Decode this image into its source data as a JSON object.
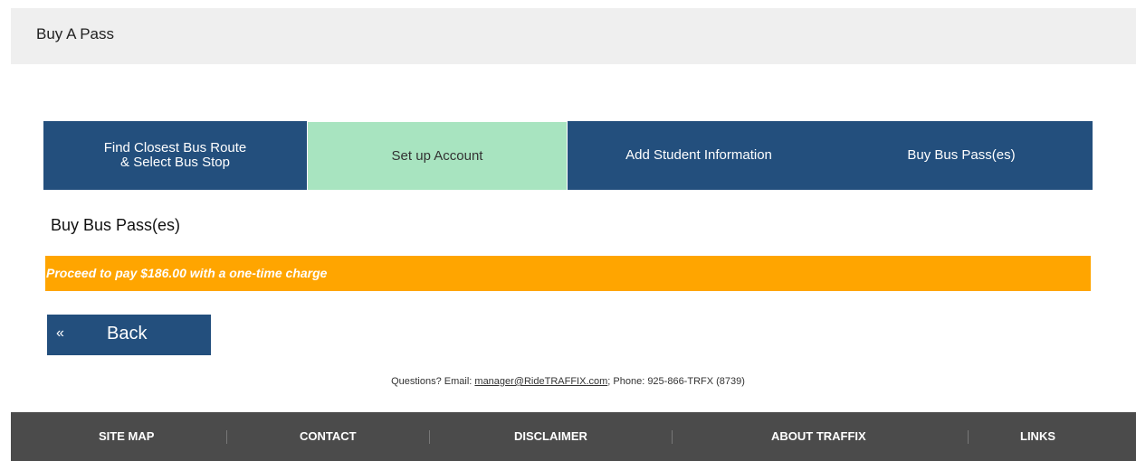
{
  "header": {
    "title": "Buy A Pass"
  },
  "steps": [
    {
      "label": "Find Closest Bus Route\n& Select Bus Stop",
      "active": false
    },
    {
      "label": "Set up Account",
      "active": true
    },
    {
      "label": "Add Student Information",
      "active": false
    },
    {
      "label": "Buy Bus Pass(es)",
      "active": false
    }
  ],
  "main": {
    "section_title": "Buy Bus Pass(es)",
    "notice": "Proceed to pay $186.00 with a one-time charge",
    "back_chevron": "«",
    "back_label": "Back"
  },
  "contact": {
    "prefix": "Questions? Email: ",
    "email": "manager@RideTRAFFIX.com",
    "suffix": "; Phone: 925-866-TRFX (8739)"
  },
  "footer": {
    "items": [
      "SITE MAP",
      "CONTACT",
      "DISCLAIMER",
      "ABOUT TRAFFIX",
      "LINKS"
    ]
  },
  "colors": {
    "nav_blue": "#234f7d",
    "active_step": "#a8e4c0",
    "notice_orange": "#ffa500",
    "footer_gray": "#4b4b4b"
  }
}
